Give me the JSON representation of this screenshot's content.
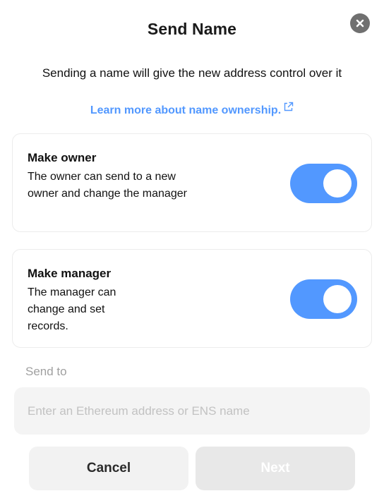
{
  "dialog": {
    "title": "Send Name",
    "subtitle": "Sending a name will give the new address control over it",
    "learn_more_link": "Learn more about name ownership.",
    "close_icon": "close-icon"
  },
  "owner_card": {
    "title": "Make owner",
    "description": "The owner can send to a new owner and change the manager",
    "toggle_on": true
  },
  "manager_card": {
    "title": "Make manager",
    "description": "The manager can change and set records.",
    "toggle_on": true
  },
  "send_to": {
    "label": "Send to",
    "value": "",
    "placeholder": "Enter an Ethereum address or ENS name"
  },
  "actions": {
    "cancel_label": "Cancel",
    "next_label": "Next",
    "next_disabled": true
  },
  "colors": {
    "accent": "#5298ff",
    "toggle_on": "#5298ff",
    "close_button": "#707070",
    "input_bg": "#f4f4f4",
    "disabled_button": "#e8e8e8"
  }
}
